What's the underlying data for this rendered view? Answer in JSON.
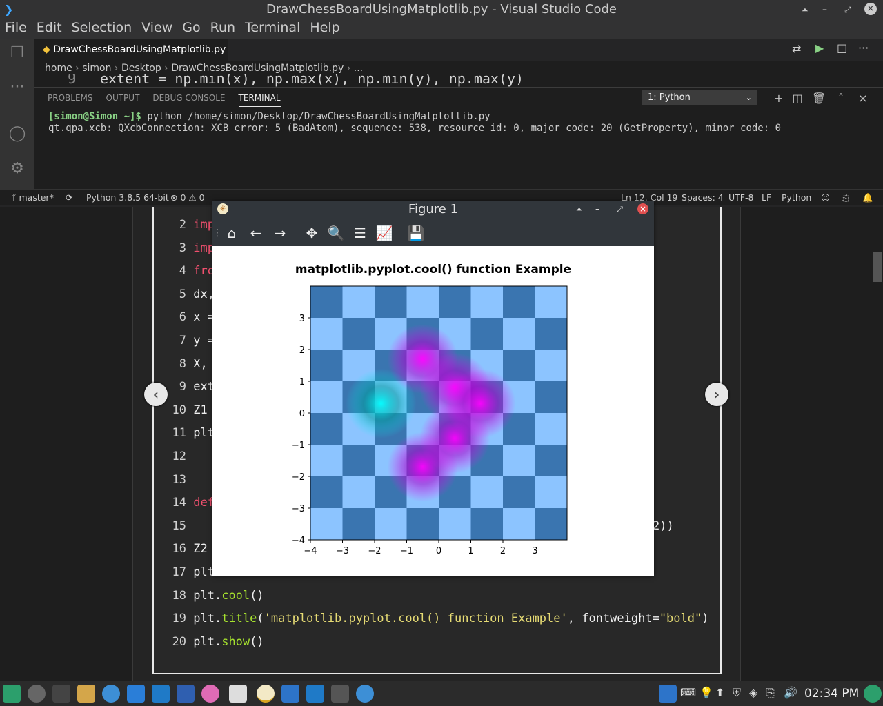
{
  "window": {
    "title": "DrawChessBoardUsingMatplotlib.py - Visual Studio Code"
  },
  "menu": [
    "File",
    "Edit",
    "Selection",
    "View",
    "Go",
    "Run",
    "Terminal",
    "Help"
  ],
  "tab": {
    "label": "DrawChessBoardUsingMatplotlib.py",
    "close": "×"
  },
  "breadcrumb": {
    "items": [
      "home",
      "simon",
      "Desktop",
      "DrawChessBoardUsingMatplotlib.py",
      "..."
    ]
  },
  "editor_peek": {
    "line_number": "9",
    "code": "extent = np.min(x), np.max(x), np.min(y), np.max(y)"
  },
  "panel": {
    "tabs": [
      "PROBLEMS",
      "OUTPUT",
      "DEBUG CONSOLE",
      "TERMINAL"
    ],
    "active_tab": "TERMINAL",
    "terminal_select": "1: Python",
    "prompt": "[simon@Simon ~]$",
    "command": " python /home/simon/Desktop/DrawChessBoardUsingMatplotlib.py",
    "output": "qt.qpa.xcb: QXcbConnection: XCB error: 5 (BadAtom), sequence: 538, resource id: 0, major code: 20 (GetProperty), minor code: 0"
  },
  "status": {
    "branch": "master*",
    "interpreter": "Python 3.8.5 64-bit",
    "errors": "0",
    "warnings": "0",
    "position": "Ln 12, Col 19",
    "spaces": "Spaces: 4",
    "encoding": "UTF-8",
    "eol": "LF",
    "language": "Python"
  },
  "figure": {
    "title": "Figure 1"
  },
  "code_lines": [
    {
      "n": "2",
      "text": "imp"
    },
    {
      "n": "3",
      "text": "imp"
    },
    {
      "n": "4",
      "text": "fro"
    },
    {
      "n": "5",
      "text": "dx,"
    },
    {
      "n": "6",
      "text": "x ="
    },
    {
      "n": "7",
      "text": "y ="
    },
    {
      "n": "8",
      "text": "X,"
    },
    {
      "n": "9",
      "text": "ext"
    },
    {
      "n": "10",
      "text": "Z1"
    },
    {
      "n": "11",
      "text": "plt"
    },
    {
      "n": "12",
      "text": ""
    },
    {
      "n": "13",
      "text": ""
    },
    {
      "n": "14",
      "text": "def"
    },
    {
      "n": "15",
      "text": ""
    },
    {
      "n": "16",
      "text": "Z2"
    },
    {
      "n": "17",
      "text": "plt"
    },
    {
      "n": "18",
      "text": "plt.cool()"
    },
    {
      "n": "19",
      "text": "plt.title('matplotlib.pyplot.cool() function Example', fontweight=\"bold\")"
    },
    {
      "n": "20",
      "text": "plt.show()"
    }
  ],
  "code_line15_tail": "2))",
  "clock": "02:34 PM",
  "chart_data": {
    "type": "heatmap",
    "title": "matplotlib.pyplot.cool() function Example",
    "xlabel": "",
    "ylabel": "",
    "xlim": [
      -4,
      4
    ],
    "ylim": [
      -4,
      4
    ],
    "xticks": [
      "−4",
      "−3",
      "−2",
      "−1",
      "0",
      "1",
      "2",
      "3"
    ],
    "yticks": [
      "3",
      "2",
      "1",
      "0",
      "−1",
      "−2",
      "−3",
      "−4"
    ],
    "checker_colors": [
      "#3a75b0",
      "#8cc4ff"
    ],
    "colormap": "cool",
    "blobs": [
      {
        "x": -1.8,
        "y": 0.3,
        "sign": -1
      },
      {
        "x": -0.5,
        "y": 1.7,
        "sign": 1
      },
      {
        "x": -0.5,
        "y": -1.7,
        "sign": 1
      },
      {
        "x": 0.5,
        "y": 0.8,
        "sign": 1
      },
      {
        "x": 0.5,
        "y": -0.8,
        "sign": 1
      },
      {
        "x": 1.3,
        "y": 0.3,
        "sign": 1
      }
    ]
  }
}
